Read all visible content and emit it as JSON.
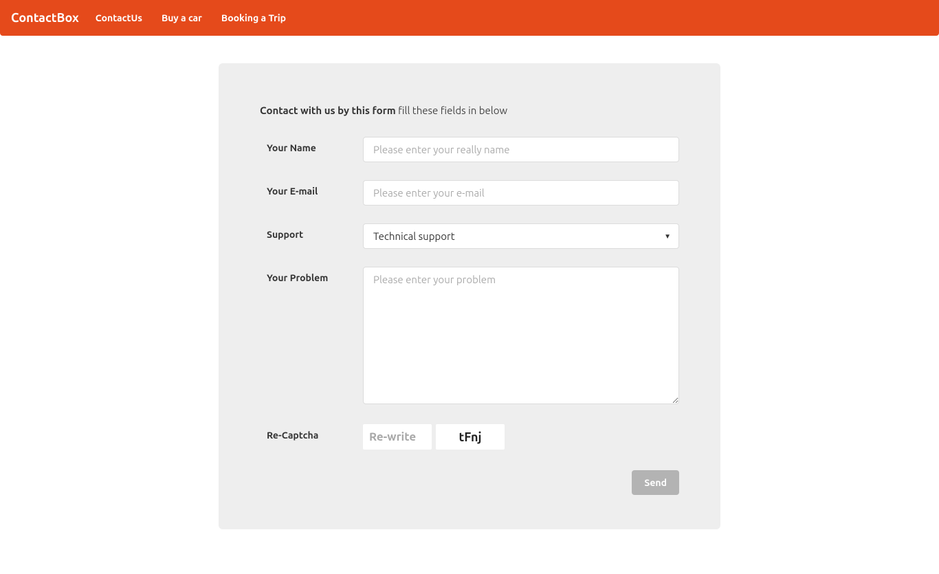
{
  "navbar": {
    "brand": "ContactBox",
    "links": [
      {
        "label": "ContactUs"
      },
      {
        "label": "Buy a car"
      },
      {
        "label": "Booking a Trip"
      }
    ]
  },
  "form": {
    "heading_bold": "Contact with us by this form",
    "heading_light": "fill these fields in below",
    "fields": {
      "name": {
        "label": "Your Name",
        "placeholder": "Please enter your really name",
        "value": ""
      },
      "email": {
        "label": "Your E-mail",
        "placeholder": "Please enter your e-mail",
        "value": ""
      },
      "support": {
        "label": "Support",
        "selected": "Technical support"
      },
      "problem": {
        "label": "Your Problem",
        "placeholder": "Please enter your problem",
        "value": ""
      },
      "captcha": {
        "label": "Re-Captcha",
        "placeholder": "Re-write",
        "value": "",
        "challenge": "tFnj"
      }
    },
    "submit_label": "Send"
  }
}
